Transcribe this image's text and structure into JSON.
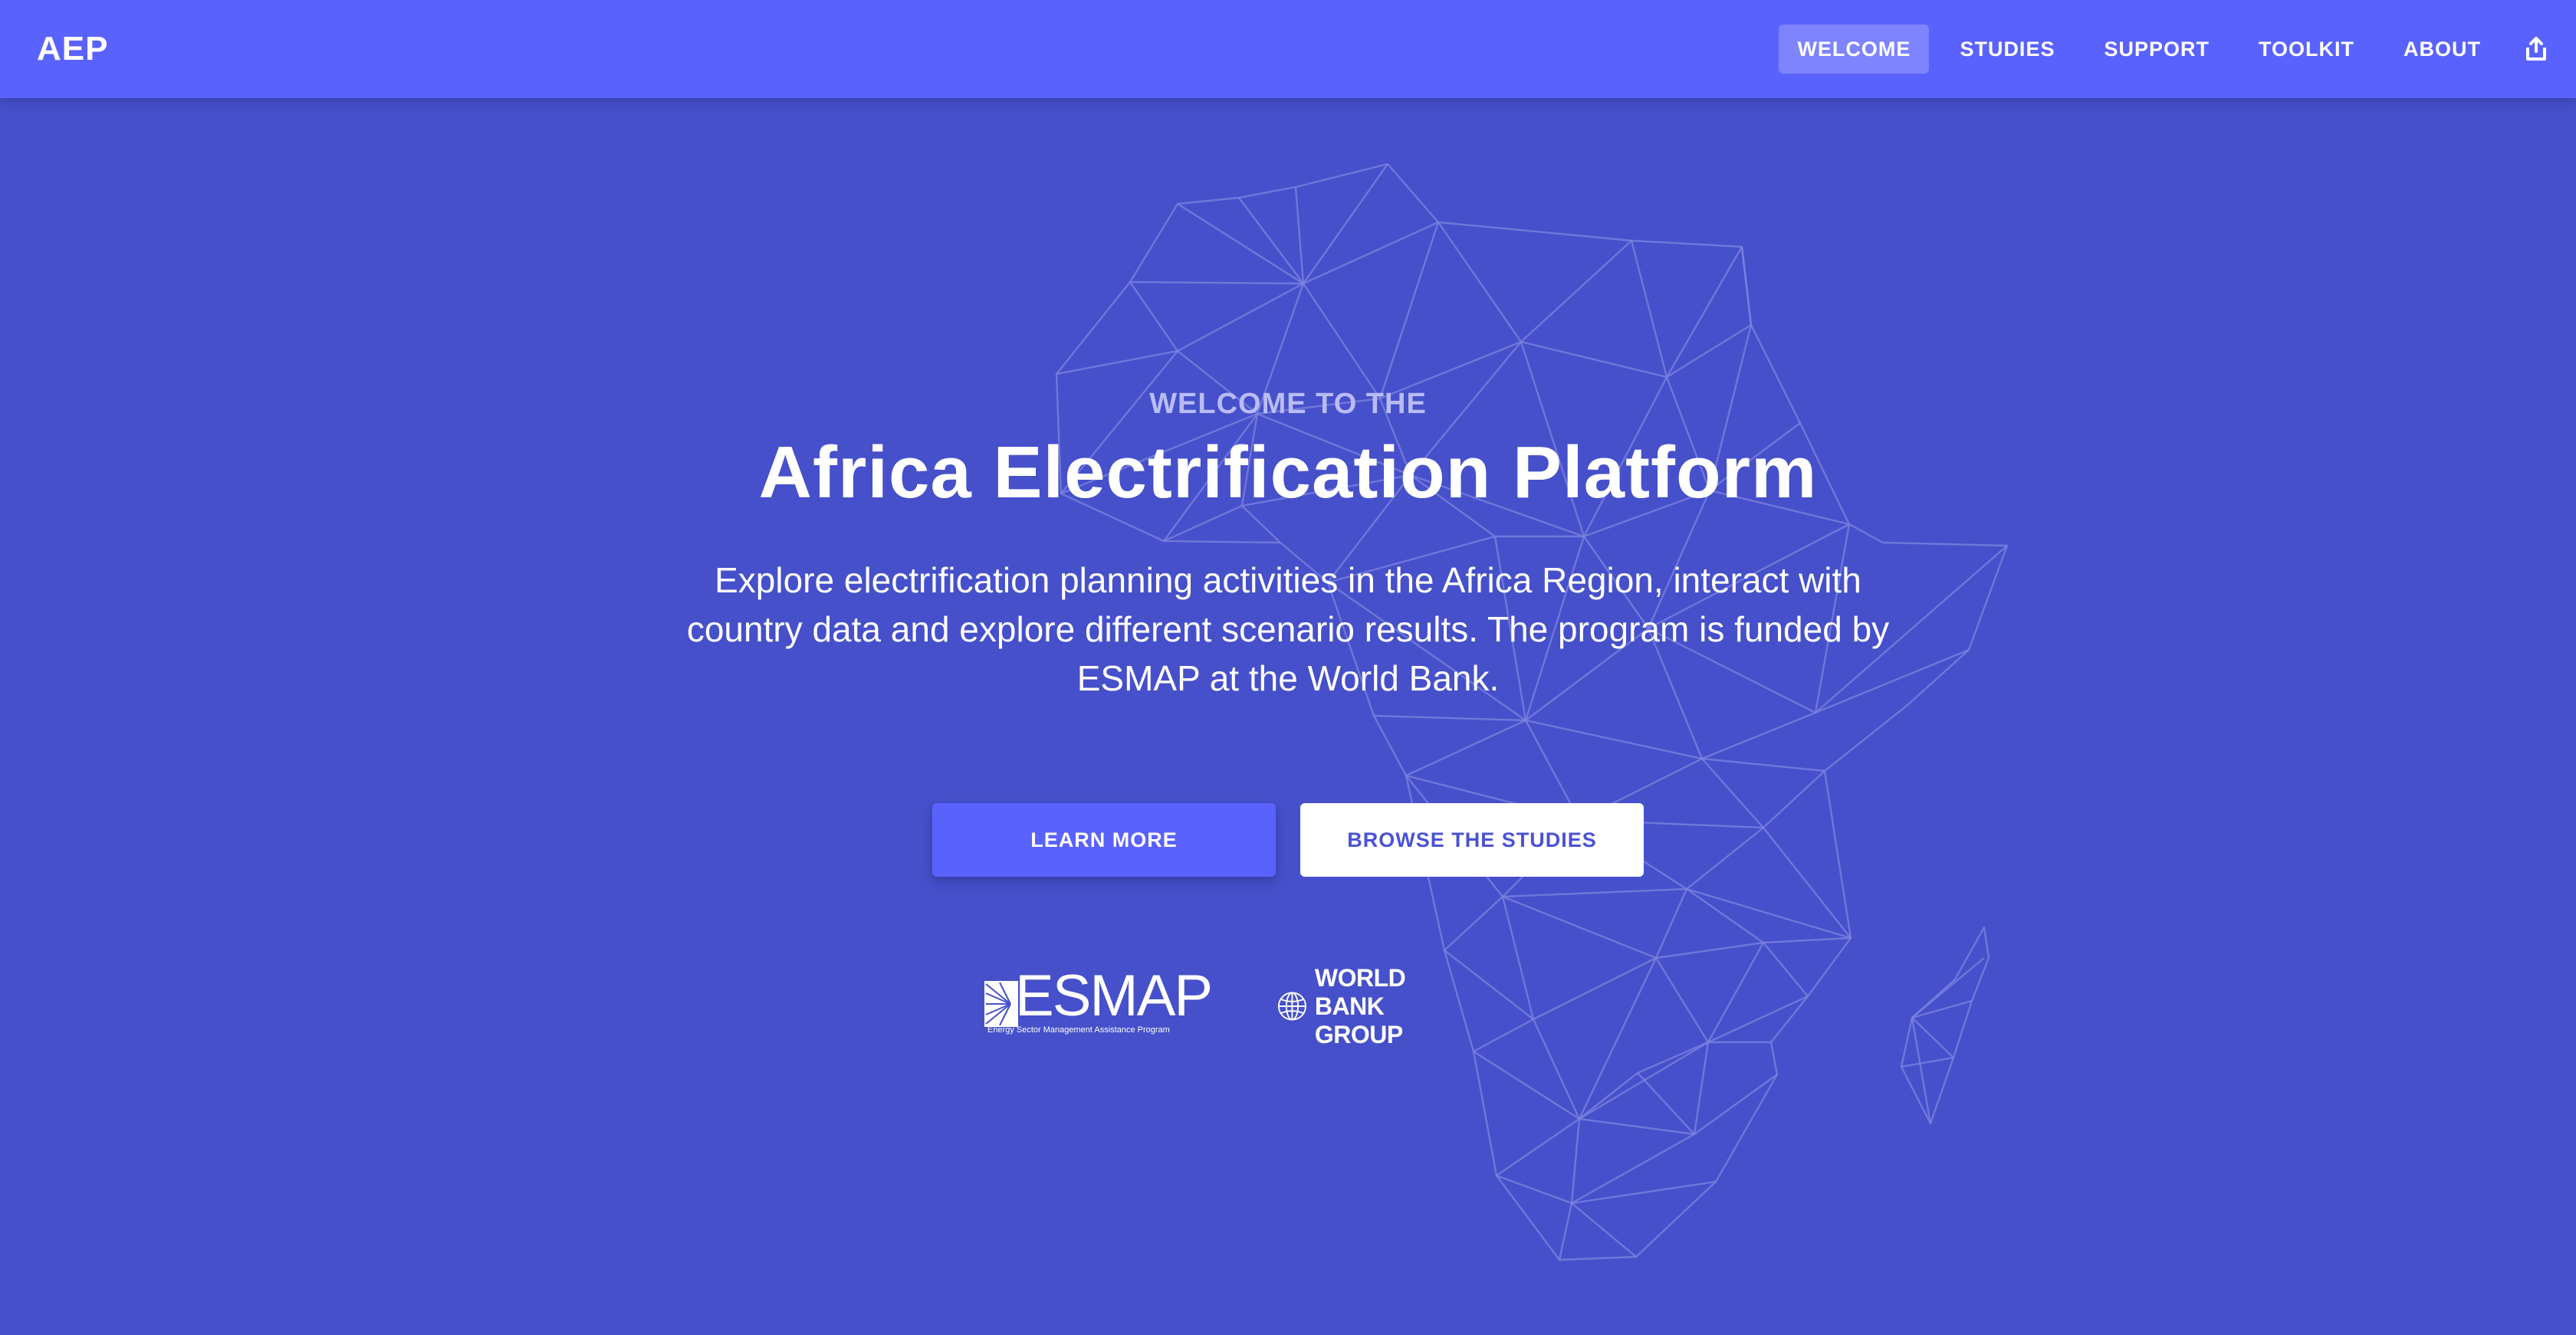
{
  "header": {
    "brand": "AEP",
    "nav": [
      {
        "label": "WELCOME",
        "active": true
      },
      {
        "label": "STUDIES",
        "active": false
      },
      {
        "label": "SUPPORT",
        "active": false
      },
      {
        "label": "TOOLKIT",
        "active": false
      },
      {
        "label": "ABOUT",
        "active": false
      }
    ],
    "share_icon": "share-icon"
  },
  "hero": {
    "eyebrow": "WELCOME TO THE",
    "title": "Africa Electrification Platform",
    "description_lines": [
      "Explore electrification planning activities in the Africa Region, interact with",
      "country data and explore different scenario results. The program is funded by",
      "ESMAP at the World Bank."
    ],
    "primary_button": "LEARN MORE",
    "secondary_button": "BROWSE THE STUDIES"
  },
  "partners": {
    "esmap": {
      "name": "ESMAP",
      "tagline": "Energy Sector Management Assistance Program"
    },
    "world_bank": {
      "name": "WORLD BANK GROUP"
    }
  },
  "colors": {
    "background": "#4650ca",
    "topbar": "#5a62fe",
    "primary_button": "#5a62fe",
    "secondary_button_text": "#4a52d6",
    "eyebrow": "#b9bcf4",
    "map_lines": "#7e84e0"
  }
}
